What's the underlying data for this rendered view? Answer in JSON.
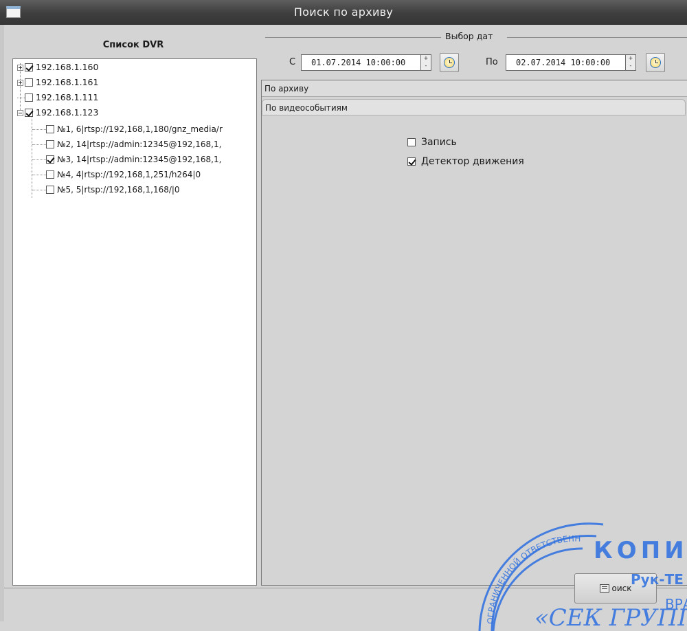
{
  "window": {
    "title": "Поиск по архиву"
  },
  "dvr_list": {
    "header": "Список DVR",
    "items": [
      {
        "label": "192.168.1.160",
        "checked": true,
        "expander": "plus"
      },
      {
        "label": "192.168.1.161",
        "checked": false,
        "expander": "plus"
      },
      {
        "label": "192.168.1.111",
        "checked": false,
        "expander": "none"
      },
      {
        "label": "192.168.1.123",
        "checked": true,
        "expander": "minus"
      }
    ],
    "children": [
      {
        "label": "№1, 6|rtsp://192,168,1,180/gnz_media/r",
        "checked": false
      },
      {
        "label": "№2, 14|rtsp://admin:12345@192,168,1,",
        "checked": false
      },
      {
        "label": "№3, 14|rtsp://admin:12345@192,168,1,",
        "checked": true
      },
      {
        "label": "№4, 4|rtsp://192,168,1,251/h264|0",
        "checked": false
      },
      {
        "label": "№5, 5|rtsp://192,168,1,168/|0",
        "checked": false
      }
    ]
  },
  "date_selection": {
    "label": "Выбор дат",
    "from_label": "С",
    "from_value": "01.07.2014 10:00:00",
    "to_label": "По",
    "to_value": "02.07.2014 10:00:00",
    "spin_up": "+",
    "spin_down": "-"
  },
  "accordion": {
    "section_archive": "По архиву",
    "section_events": "По видеособытиям"
  },
  "event_options": [
    {
      "label": "Запись",
      "checked": false
    },
    {
      "label": "Детектор движения",
      "checked": true
    }
  ],
  "actions": {
    "search_label": "оиск"
  },
  "stamp": {
    "text_top": "КОПИЯ",
    "text_arc": "ОГРАНИЧЕННОЙ ОТВЕТСТВЕННОСТЬЮ",
    "text_mid": "Рук-ТЕ",
    "text_bottom": "«СЕК ГРУПП»",
    "text_side": "ВРА",
    "color": "#2d6fe0"
  },
  "colors": {
    "window_bg": "#d4d4d4",
    "titlebar": "#3e3e3e",
    "stamp_blue": "#2d6fe0"
  }
}
